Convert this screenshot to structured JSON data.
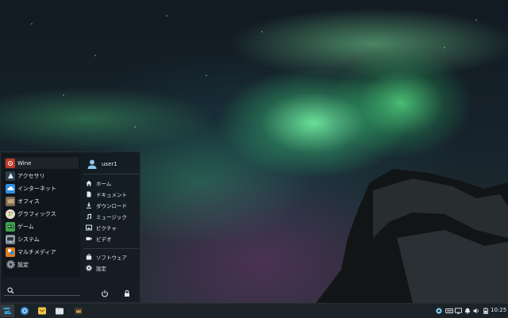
{
  "menu": {
    "categories": [
      {
        "label": "Wine",
        "icon": "wine-icon",
        "color": "#c0392b"
      },
      {
        "label": "アクセサリ",
        "icon": "accessories-icon",
        "color": "#2c3e50"
      },
      {
        "label": "インターネット",
        "icon": "internet-cloud-icon",
        "color": "#2d8fe0"
      },
      {
        "label": "オフィス",
        "icon": "office-icon",
        "color": "#7f6a55"
      },
      {
        "label": "グラフィックス",
        "icon": "graphics-palette-icon",
        "color": "#e8e0c8"
      },
      {
        "label": "ゲーム",
        "icon": "games-controller-icon",
        "color": "#3fa34d"
      },
      {
        "label": "システム",
        "icon": "system-monitor-icon",
        "color": "#7a8a94"
      },
      {
        "label": "マルチメディア",
        "icon": "multimedia-icon",
        "color": "#e07b1f"
      },
      {
        "label": "設定",
        "icon": "settings-gear-icon",
        "color": "#8a96a0"
      }
    ],
    "search": {
      "placeholder": "",
      "value": ""
    },
    "user": {
      "name": "user1"
    },
    "places": [
      {
        "label": "ホーム",
        "icon": "home-icon"
      },
      {
        "label": "ドキュメント",
        "icon": "document-icon"
      },
      {
        "label": "ダウンロード",
        "icon": "download-icon"
      },
      {
        "label": "ミュージック",
        "icon": "music-icon"
      },
      {
        "label": "ピクチャ",
        "icon": "pictures-icon"
      },
      {
        "label": "ビデオ",
        "icon": "video-icon"
      }
    ],
    "system": [
      {
        "label": "ソフトウェア",
        "icon": "software-bag-icon"
      },
      {
        "label": "設定",
        "icon": "settings-gear-icon"
      }
    ]
  },
  "taskbar": {
    "apps": [
      {
        "icon": "zorin-menu-icon",
        "active": true
      },
      {
        "icon": "web-browser-icon"
      },
      {
        "icon": "mail-icon"
      },
      {
        "icon": "files-icon"
      },
      {
        "icon": "cat-app-icon"
      }
    ],
    "tray": [
      "network-icon",
      "keyboard-icon",
      "display-icon",
      "notification-icon",
      "volume-icon",
      "battery-icon"
    ],
    "clock": "10:25"
  },
  "colors": {
    "accent": "#2fa8e0",
    "panel": "#1c2328"
  }
}
